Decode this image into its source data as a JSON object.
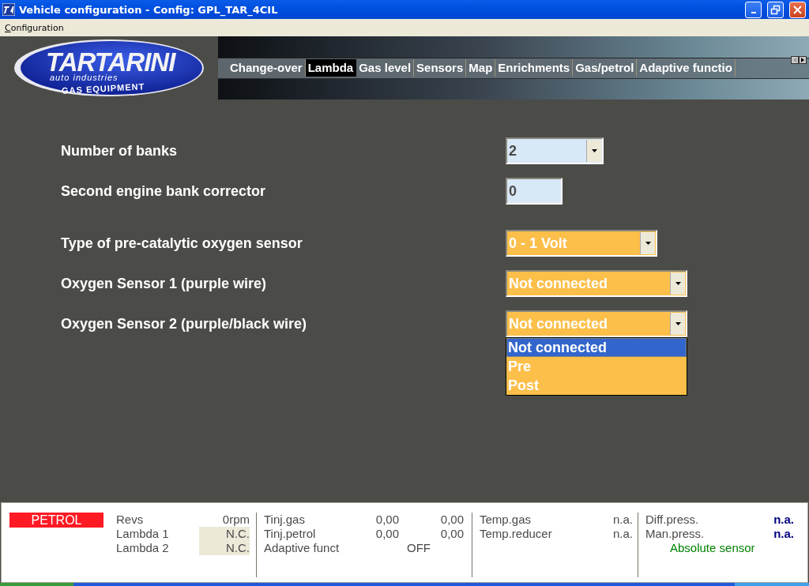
{
  "window": {
    "title": "Vehicle configuration - Config: GPL_TAR_4CIL"
  },
  "menu": [
    {
      "label": "Configuration"
    }
  ],
  "logo": {
    "name": "TARTARINI",
    "tagline": "auto industries",
    "subtitle": "GAS EQUIPMENT"
  },
  "tabs": [
    {
      "label": "Change-over",
      "selected": false
    },
    {
      "label": "Lambda",
      "selected": true
    },
    {
      "label": "Gas level",
      "selected": false
    },
    {
      "label": "Sensors",
      "selected": false
    },
    {
      "label": "Map",
      "selected": false
    },
    {
      "label": "Enrichments",
      "selected": false
    },
    {
      "label": "Gas/petrol",
      "selected": false
    },
    {
      "label": "Adaptive functio",
      "selected": false
    }
  ],
  "form": {
    "groups": [
      [
        {
          "label": "Number of banks",
          "kind": "select",
          "value": "2",
          "color": "#d9e8f7"
        },
        {
          "label": "Second engine bank corrector",
          "kind": "input",
          "value": "0",
          "color": "#d9e8f7"
        }
      ],
      [
        {
          "label": "Type of pre-catalytic oxygen sensor",
          "kind": "select",
          "value": "0 - 1 Volt",
          "color": "#fcbf4a"
        },
        {
          "label": "Oxygen Sensor 1 (purple wire)",
          "kind": "select",
          "value": "Not connected",
          "color": "#fcbf4a"
        },
        {
          "label": "Oxygen Sensor 2 (purple/black wire)",
          "kind": "select",
          "value": "Not connected",
          "color": "#fcbf4a",
          "expanded": true,
          "options": [
            {
              "label": "Not connected",
              "selected": true
            },
            {
              "label": "Pre",
              "selected": false
            },
            {
              "label": "Post",
              "selected": false
            }
          ]
        }
      ]
    ]
  },
  "status_bar": {
    "mode": "PETROL",
    "sections": [
      {
        "rows": [
          {
            "label": "Revs",
            "values": [
              "0rpm"
            ],
            "shaded": false
          },
          {
            "label": "Lambda 1",
            "values": [
              "N.C."
            ],
            "shaded": true
          },
          {
            "label": "Lambda 2",
            "values": [
              "N.C."
            ],
            "shaded": true
          }
        ]
      },
      {
        "rows": [
          {
            "label": "Tinj.gas",
            "values": [
              "0,00",
              "0,00"
            ],
            "shaded": false
          },
          {
            "label": "Tinj.petrol",
            "values": [
              "0,00",
              "0,00"
            ],
            "shaded": false
          },
          {
            "label": "Adaptive funct",
            "values": [
              "OFF"
            ],
            "shaded": false
          }
        ]
      },
      {
        "rows": [
          {
            "label": "Temp.gas",
            "values": [
              "n.a."
            ],
            "shaded": false
          },
          {
            "label": "Temp.reducer",
            "values": [
              "n.a."
            ],
            "shaded": false
          }
        ]
      },
      {
        "rows": [
          {
            "label": "Diff.press.",
            "values": [
              "n.a."
            ],
            "color": "#00007f",
            "shaded": false
          },
          {
            "label": "Man.press.",
            "values": [
              "n.a."
            ],
            "color": "#00007f",
            "shaded": false
          }
        ],
        "note": {
          "text": "Absolute sensor",
          "color": "#008000"
        }
      }
    ]
  }
}
